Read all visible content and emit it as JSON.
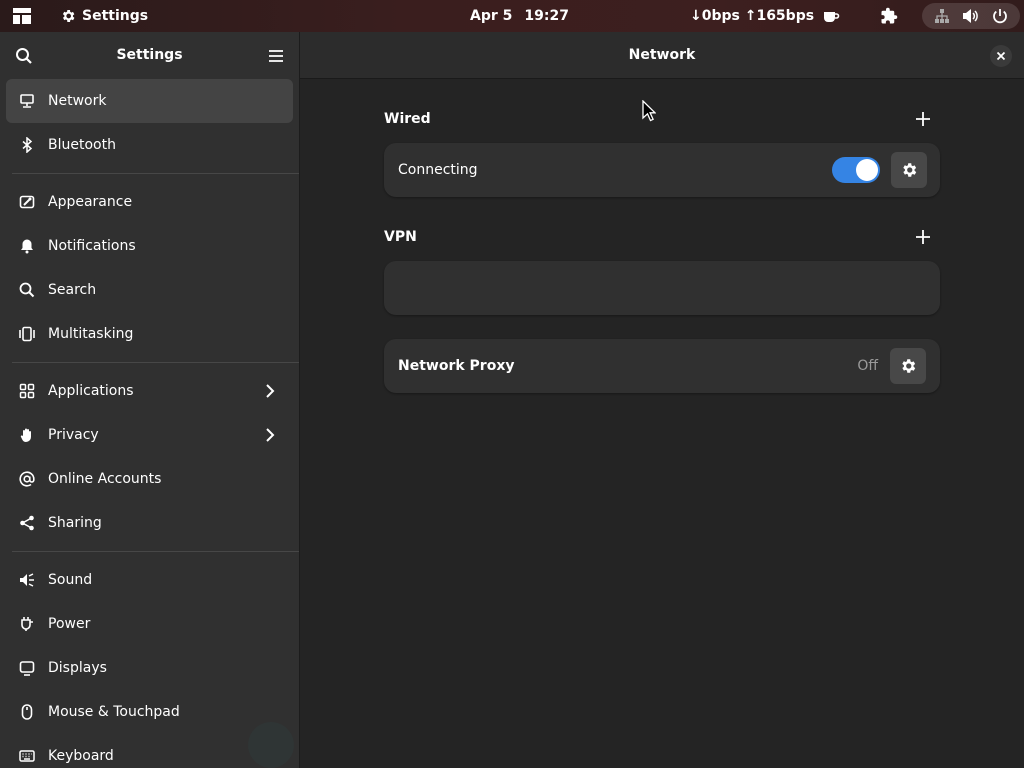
{
  "topbar": {
    "app_name": "Settings",
    "date": "Apr 5",
    "time": "19:27",
    "net_speed": "↓0bps ↑165bps",
    "icons": [
      "activities-icon",
      "gear-icon",
      "coffee-icon",
      "puzzle-extension-icon",
      "network-wired-icon",
      "volume-icon",
      "power-icon"
    ]
  },
  "sidebar": {
    "title": "Settings",
    "groups": [
      [
        {
          "label": "Network",
          "icon": "network-icon",
          "active": true
        },
        {
          "label": "Bluetooth",
          "icon": "bluetooth-icon"
        }
      ],
      [
        {
          "label": "Appearance",
          "icon": "appearance-icon"
        },
        {
          "label": "Notifications",
          "icon": "bell-icon"
        },
        {
          "label": "Search",
          "icon": "search-icon"
        },
        {
          "label": "Multitasking",
          "icon": "multitasking-icon"
        }
      ],
      [
        {
          "label": "Applications",
          "icon": "apps-grid-icon",
          "chevron": true
        },
        {
          "label": "Privacy",
          "icon": "hand-icon",
          "chevron": true
        },
        {
          "label": "Online Accounts",
          "icon": "at-icon"
        },
        {
          "label": "Sharing",
          "icon": "share-icon"
        }
      ],
      [
        {
          "label": "Sound",
          "icon": "speaker-icon"
        },
        {
          "label": "Power",
          "icon": "power-plug-icon"
        },
        {
          "label": "Displays",
          "icon": "display-icon"
        },
        {
          "label": "Mouse & Touchpad",
          "icon": "mouse-icon"
        },
        {
          "label": "Keyboard",
          "icon": "keyboard-icon"
        }
      ]
    ]
  },
  "main": {
    "title": "Network",
    "wired": {
      "heading": "Wired",
      "connection_label": "Connecting",
      "enabled": true
    },
    "vpn": {
      "heading": "VPN"
    },
    "proxy": {
      "label": "Network Proxy",
      "status": "Off"
    }
  },
  "colors": {
    "accent": "#3584e4",
    "sidebar_bg": "#303030",
    "content_bg": "#242424",
    "card_bg": "#303030"
  }
}
